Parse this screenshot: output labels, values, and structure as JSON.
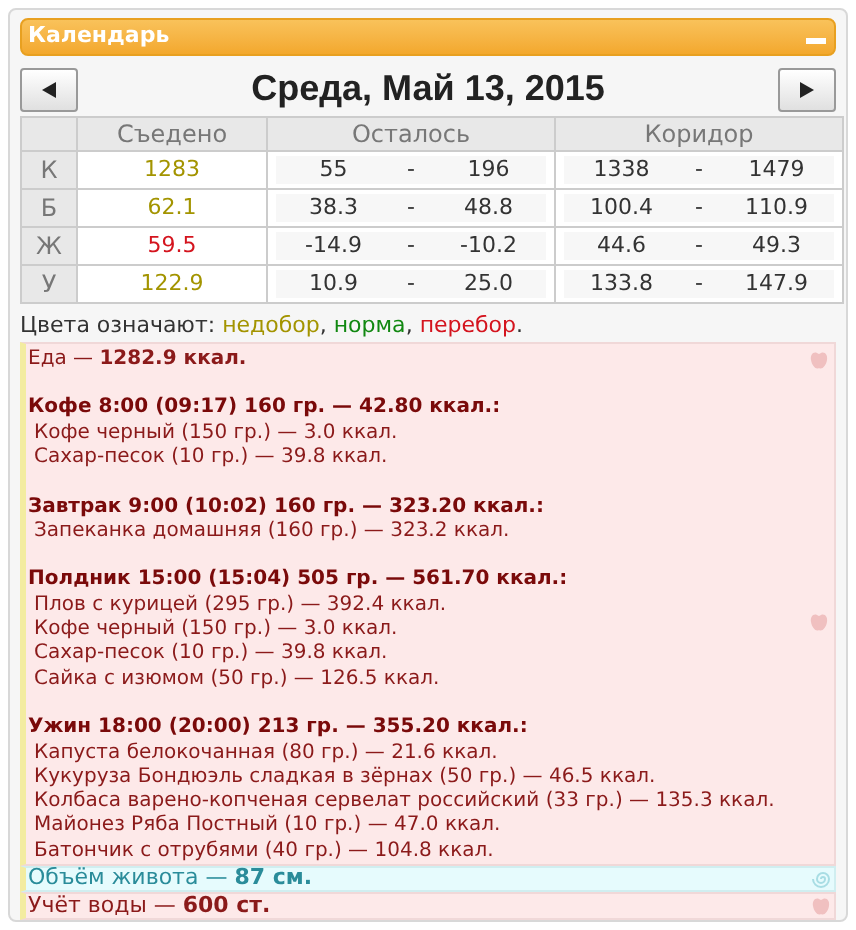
{
  "panel": {
    "title": "Календарь"
  },
  "date_nav": {
    "title": "Среда, Май 13, 2015"
  },
  "table": {
    "columns": [
      "Съедено",
      "Осталось",
      "Коридор"
    ],
    "rows": [
      {
        "label": "К",
        "eaten": "1283",
        "color": "#a39400",
        "left_min": "55",
        "left_sep": "-",
        "left_max": "196",
        "range_min": "1338",
        "range_sep": "-",
        "range_max": "1479"
      },
      {
        "label": "Б",
        "eaten": "62.1",
        "color": "#a39400",
        "left_min": "38.3",
        "left_sep": "-",
        "left_max": "48.8",
        "range_min": "100.4",
        "range_sep": "-",
        "range_max": "110.9"
      },
      {
        "label": "Ж",
        "eaten": "59.5",
        "color": "#d4141e",
        "left_min": "-14.9",
        "left_sep": "-",
        "left_max": "-10.2",
        "range_min": "44.6",
        "range_sep": "-",
        "range_max": "49.3"
      },
      {
        "label": "У",
        "eaten": "122.9",
        "color": "#a39400",
        "left_min": "10.9",
        "left_sep": "-",
        "left_max": "25.0",
        "range_min": "133.8",
        "range_sep": "-",
        "range_max": "147.9"
      }
    ]
  },
  "legend": {
    "label": "Цвета означают: ",
    "items": [
      {
        "text": "недобор",
        "color": "#a39400",
        "after": ", "
      },
      {
        "text": "норма",
        "color": "#118811",
        "after": ", "
      },
      {
        "text": "перебор",
        "color": "#d4141e",
        "after": "."
      }
    ]
  },
  "food": {
    "total": "Еда — **1282.9 ккал.**",
    "meals": [
      {
        "header": "Кофе 8:00 (09:17) 160 гр. — 42.80 ккал.:",
        "items": [
          "Кофе черный (150 гр.) — 3.0 ккал.",
          "Сахар-песок (10 гр.) — 39.8 ккал."
        ]
      },
      {
        "header": "Завтрак 9:00 (10:02) 160 гр. — 323.20 ккал.:",
        "items": [
          "Запеканка домашняя (160 гр.) — 323.2 ккал."
        ]
      },
      {
        "header": "Полдник 15:00 (15:04) 505 гр. — 561.70 ккал.:",
        "items": [
          "Плов с курицей (295 гр.) — 392.4 ккал.",
          "Кофе черный (150 гр.) — 3.0 ккал.",
          "Сахар-песок (10 гр.) — 39.8 ккал.",
          "Сайка с изюмом (50 гр.) — 126.5 ккал."
        ]
      },
      {
        "header": "Ужин 18:00 (20:00) 213 гр. — 355.20 ккал.:",
        "items": [
          "Капуста белокочанная (80 гр.) — 21.6 ккал.",
          "Кукуруза Бондюэль сладкая в зёрнах (50 гр.) — 46.5 ккал.",
          "Колбаса варено-копченая сервелат российский (33 гр.) — 135.3 ккал.",
          "Майонез Ряба Постный (10 гр.) — 47.0 ккал.",
          "Батончик с отрубями (40 гр.) — 104.8 ккал."
        ]
      }
    ]
  },
  "belly": {
    "text": "Объём живота — **87 см.**"
  },
  "water": {
    "text": "Учёт воды — **600 ст.**"
  }
}
